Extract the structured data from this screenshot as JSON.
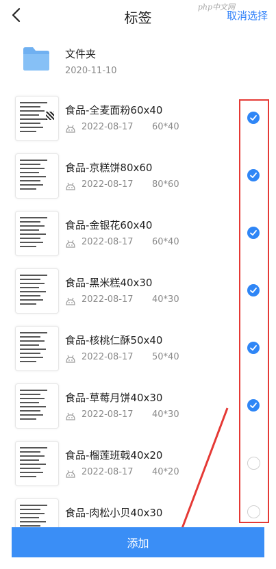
{
  "header": {
    "title": "标签",
    "cancel_label": "取消选择",
    "watermark": "php中文网"
  },
  "folder": {
    "name": "文件夹",
    "date": "2020-11-10"
  },
  "labels": [
    {
      "name": "食品-全麦面粉60x40",
      "date": "2022-08-17",
      "size": "60*40",
      "selected": true
    },
    {
      "name": "食品-京糕饼80x60",
      "date": "2022-08-17",
      "size": "80*60",
      "selected": true
    },
    {
      "name": "食品-金银花60x40",
      "date": "2022-08-17",
      "size": "60*40",
      "selected": true
    },
    {
      "name": "食品-黑米糕40x30",
      "date": "2022-08-17",
      "size": "40*30",
      "selected": true
    },
    {
      "name": "食品-核桃仁酥50x40",
      "date": "2022-08-17",
      "size": "50*40",
      "selected": true
    },
    {
      "name": "食品-草莓月饼40x30",
      "date": "2022-08-17",
      "size": "40*30",
      "selected": true
    },
    {
      "name": "食品-榴莲班戟40x20",
      "date": "2022-08-17",
      "size": "40*20",
      "selected": false
    },
    {
      "name": "食品-肉松小贝40x30",
      "date": "",
      "size": "",
      "selected": false
    }
  ],
  "footer": {
    "add_label": "添加"
  },
  "colors": {
    "accent": "#2f86f6",
    "annotation": "#e53935"
  }
}
